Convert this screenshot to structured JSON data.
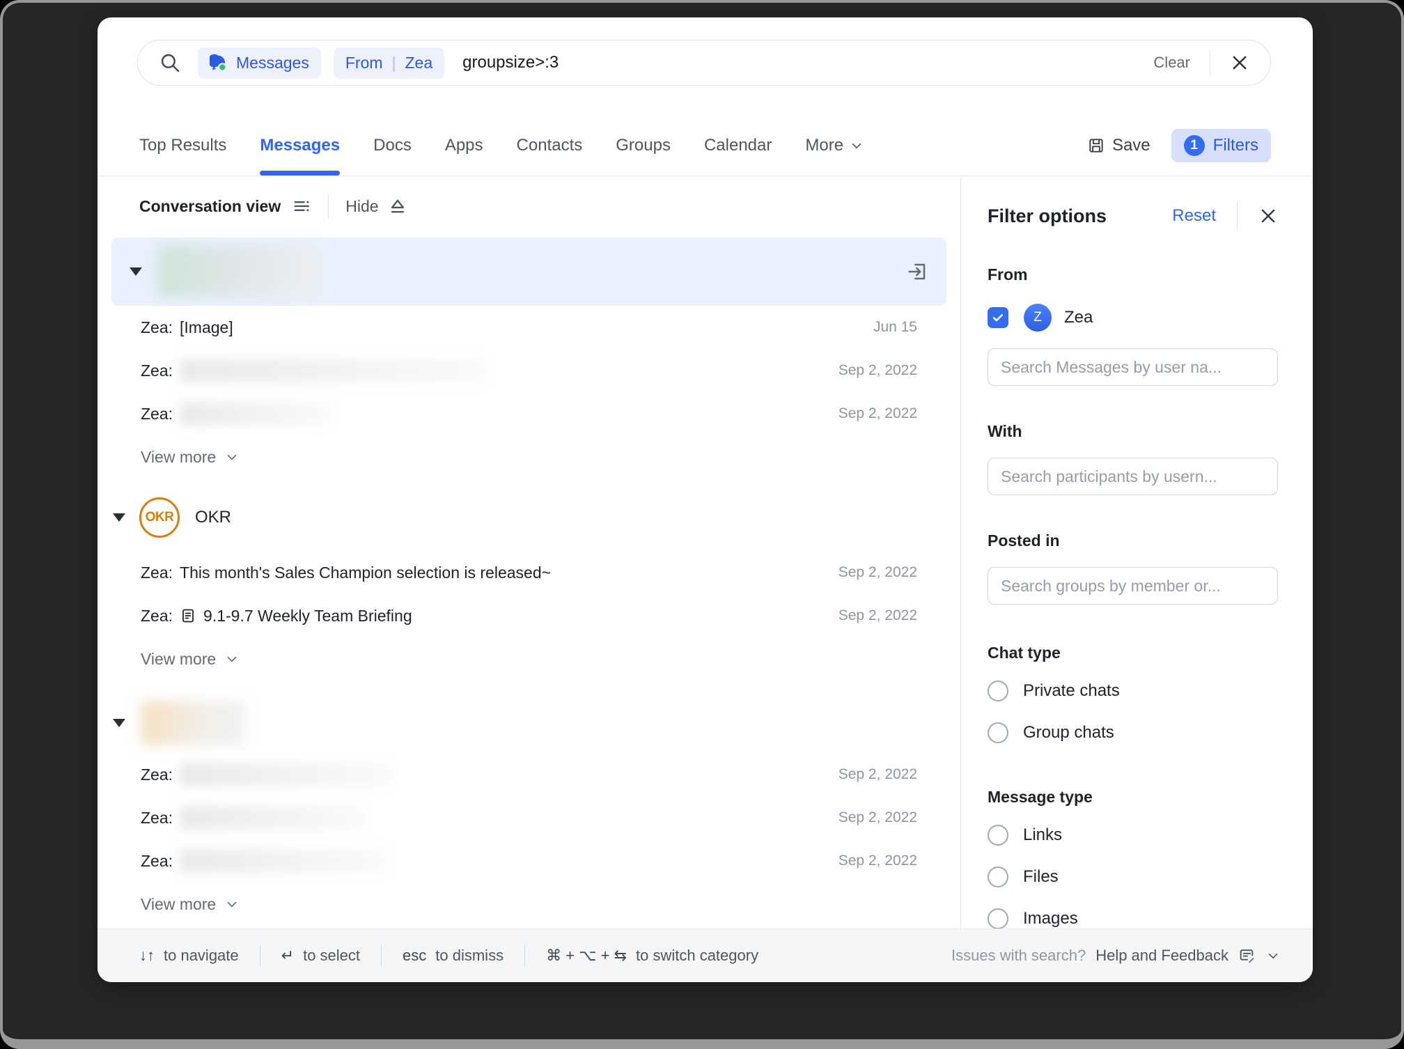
{
  "colors": {
    "accent_blue": "#3364EF",
    "component_blue": "#336DF4",
    "chip_bg": "#EDF1FD",
    "filters_btn_bg": "#D7E0FB",
    "highlight_row_bg": "#E9F1FE",
    "okr_orange": "#D77D0B",
    "text_primary": "#1F2329",
    "text_secondary": "#50555C",
    "text_tertiary": "#8F959E",
    "footer_bg": "#F5F6F7",
    "frame_dark": "#262626"
  },
  "search_bar": {
    "scope_chip": "Messages",
    "from_chip_key": "From",
    "from_chip_value": "Zea",
    "query": "groupsize>:3",
    "clear_label": "Clear"
  },
  "tabs": {
    "items": [
      {
        "label": "Top Results"
      },
      {
        "label": "Messages"
      },
      {
        "label": "Docs"
      },
      {
        "label": "Apps"
      },
      {
        "label": "Contacts"
      },
      {
        "label": "Groups"
      },
      {
        "label": "Calendar"
      },
      {
        "label": "More"
      }
    ],
    "save_label": "Save",
    "filters_label": "Filters",
    "filters_count": "1"
  },
  "results": {
    "header": {
      "title": "Conversation view",
      "hide_label": "Hide"
    },
    "view_more_label": "View more",
    "groups": [
      {
        "messages": [
          {
            "sender": "Zea:",
            "text": "[Image]",
            "date": "Jun 15"
          },
          {
            "sender": "Zea:",
            "date": "Sep 2, 2022"
          },
          {
            "sender": "Zea:",
            "date": "Sep 2, 2022"
          }
        ]
      },
      {
        "name": "OKR",
        "avatar_text": "OKR",
        "messages": [
          {
            "sender": "Zea:",
            "text": "This month's Sales Champion selection is released~",
            "date": "Sep 2, 2022"
          },
          {
            "sender": "Zea:",
            "text": "9.1-9.7 Weekly Team Briefing",
            "date": "Sep 2, 2022"
          }
        ]
      },
      {
        "messages": [
          {
            "sender": "Zea:",
            "date": "Sep 2, 2022"
          },
          {
            "sender": "Zea:",
            "date": "Sep 2, 2022"
          },
          {
            "sender": "Zea:",
            "date": "Sep 2, 2022"
          }
        ]
      }
    ]
  },
  "filter_panel": {
    "title": "Filter options",
    "reset_label": "Reset",
    "from": {
      "heading": "From",
      "selected_user": "Zea",
      "avatar_letter": "Z",
      "placeholder": "Search Messages by user na..."
    },
    "with": {
      "heading": "With",
      "placeholder": "Search participants by usern..."
    },
    "posted_in": {
      "heading": "Posted in",
      "placeholder": "Search groups by member or..."
    },
    "chat_type": {
      "heading": "Chat type",
      "options": [
        {
          "label": "Private chats"
        },
        {
          "label": "Group chats"
        }
      ]
    },
    "message_type": {
      "heading": "Message type",
      "options": [
        {
          "label": "Links"
        },
        {
          "label": "Files"
        },
        {
          "label": "Images"
        }
      ]
    }
  },
  "footer": {
    "shortcuts": [
      {
        "keys": "↓↑",
        "label": "to navigate"
      },
      {
        "keys": "↵",
        "label": "to select"
      },
      {
        "keys": "esc",
        "label": "to dismiss"
      },
      {
        "keys": "⌘ + ⌥ + ⇆",
        "label": "to switch category"
      }
    ],
    "issues_label": "Issues with search?",
    "help_label": "Help and Feedback"
  }
}
